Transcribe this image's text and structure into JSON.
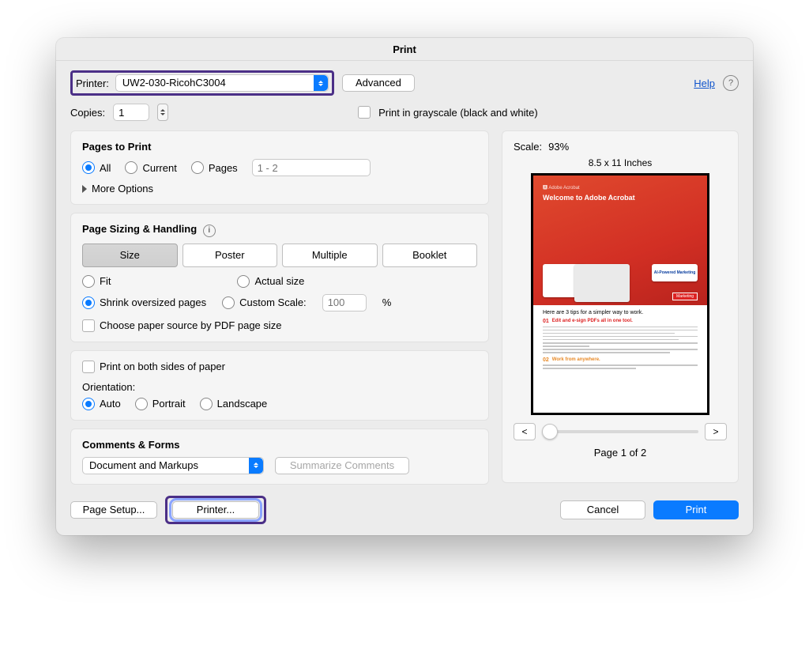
{
  "title": "Print",
  "header": {
    "printer_label": "Printer:",
    "printer_value": "UW2-030-RicohC3004",
    "advanced": "Advanced",
    "help": "Help"
  },
  "copies": {
    "label": "Copies:",
    "value": "1",
    "grayscale_label": "Print in grayscale (black and white)"
  },
  "pages_to_print": {
    "heading": "Pages to Print",
    "all": "All",
    "current": "Current",
    "pages": "Pages",
    "range_placeholder": "1 - 2",
    "more_options": "More Options"
  },
  "sizing": {
    "heading": "Page Sizing & Handling",
    "size": "Size",
    "poster": "Poster",
    "multiple": "Multiple",
    "booklet": "Booklet",
    "fit": "Fit",
    "actual": "Actual size",
    "shrink": "Shrink oversized pages",
    "custom": "Custom Scale:",
    "custom_value": "100",
    "percent": "%",
    "paper_source": "Choose paper source by PDF page size"
  },
  "duplex": {
    "both_sides": "Print on both sides of paper",
    "orientation_label": "Orientation:",
    "auto": "Auto",
    "portrait": "Portrait",
    "landscape": "Landscape"
  },
  "comments": {
    "heading": "Comments & Forms",
    "value": "Document and Markups",
    "summarize": "Summarize Comments"
  },
  "preview": {
    "scale_label": "Scale:",
    "scale_value": "93%",
    "paper_size": "8.5 x 11 Inches",
    "doc_top_small": "Adobe Acrobat",
    "doc_title": "Welcome to Adobe Acrobat",
    "badge": "AI-Powered Marketing",
    "tag": "Marketing",
    "tips_header": "Here are 3 tips for a simpler way to work.",
    "tip01_num": "01",
    "tip01": "Edit and e-sign PDFs all in one tool.",
    "tip02_num": "02",
    "tip02": "Work from anywhere.",
    "prev": "<",
    "next": ">",
    "page_indicator": "Page 1 of 2"
  },
  "footer": {
    "page_setup": "Page Setup...",
    "printer": "Printer...",
    "cancel": "Cancel",
    "print": "Print"
  }
}
